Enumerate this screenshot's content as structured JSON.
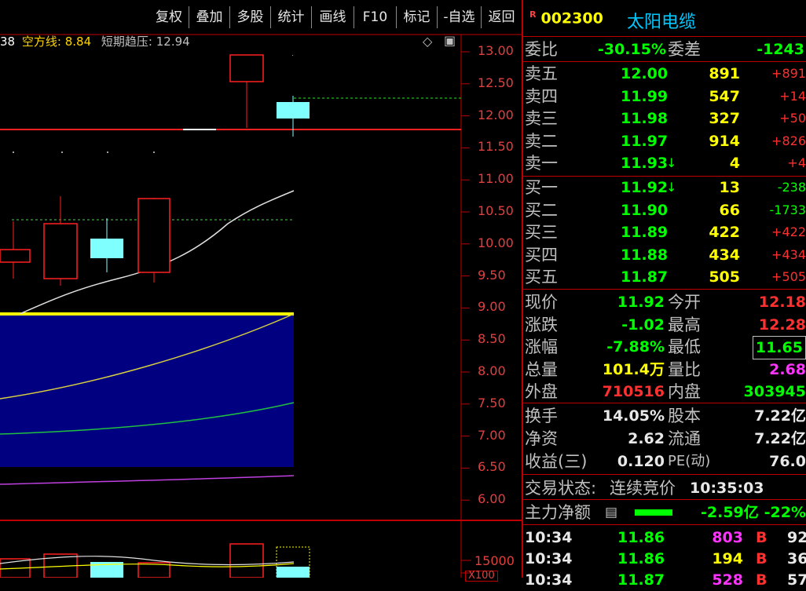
{
  "toolbar": {
    "buttons": [
      "复权",
      "叠加",
      "多股",
      "统计",
      "画线",
      "F10",
      "标记",
      "-自选",
      "返回"
    ]
  },
  "chart": {
    "legend_prefix": "38",
    "legend_label1": "空方线:",
    "legend_value1": "8.84",
    "legend_label2": "短期趋压:",
    "legend_value2": "12.94",
    "y_labels": [
      "13.00",
      "12.50",
      "12.00",
      "11.50",
      "11.00",
      "10.50",
      "10.00",
      "9.50",
      "9.00",
      "8.50",
      "8.00",
      "7.50",
      "7.00",
      "6.50",
      "6.00"
    ],
    "vol_label": "15000",
    "vol_unit": "X100",
    "diamond_icon": "◇",
    "window_icon": "▣"
  },
  "stock": {
    "badge": "R",
    "code": "002300",
    "name": "太阳电缆"
  },
  "quote": {
    "weibi_label": "委比",
    "weibi": "-30.15%",
    "weicha_label": "委差",
    "weicha": "-1243",
    "asks": [
      {
        "label": "卖五",
        "price": "12.00",
        "vol": "891",
        "chg": "+891"
      },
      {
        "label": "卖四",
        "price": "11.99",
        "vol": "547",
        "chg": "+14"
      },
      {
        "label": "卖三",
        "price": "11.98",
        "vol": "327",
        "chg": "+50"
      },
      {
        "label": "卖二",
        "price": "11.97",
        "vol": "914",
        "chg": "+826"
      },
      {
        "label": "卖一",
        "price": "11.93",
        "arrow": "↓",
        "vol": "4",
        "chg": "+4"
      }
    ],
    "bids": [
      {
        "label": "买一",
        "price": "11.92",
        "arrow": "↓",
        "vol": "13",
        "chg": "-238"
      },
      {
        "label": "买二",
        "price": "11.90",
        "vol": "66",
        "chg": "-1733"
      },
      {
        "label": "买三",
        "price": "11.89",
        "vol": "422",
        "chg": "+422"
      },
      {
        "label": "买四",
        "price": "11.88",
        "vol": "434",
        "chg": "+434"
      },
      {
        "label": "买五",
        "price": "11.87",
        "vol": "505",
        "chg": "+505"
      }
    ],
    "stats": [
      {
        "l1": "现价",
        "v1": "11.92",
        "l2": "今开",
        "v2": "12.18"
      },
      {
        "l1": "涨跌",
        "v1": "-1.02",
        "l2": "最高",
        "v2": "12.28"
      },
      {
        "l1": "涨幅",
        "v1": "-7.88%",
        "l2": "最低",
        "v2": "11.65"
      },
      {
        "l1": "总量",
        "v1": "101.4万",
        "l2": "量比",
        "v2": "2.68"
      },
      {
        "l1": "外盘",
        "v1": "710516",
        "l2": "内盘",
        "v2": "303945"
      }
    ],
    "fund": [
      {
        "l1": "换手",
        "v1": "14.05%",
        "l2": "股本",
        "v2": "7.22亿"
      },
      {
        "l1": "净资",
        "v1": "2.62",
        "l2": "流通",
        "v2": "7.22亿"
      },
      {
        "l1": "收益(三)",
        "v1": "0.120",
        "l2": "PE(动)",
        "v2": "76.0"
      }
    ],
    "trade_status_label": "交易状态:",
    "trade_status": "连续竞价",
    "trade_time": "10:35:03",
    "main_net_label": "主力净额",
    "main_net_icon": "▤",
    "main_net": "-2.59亿",
    "main_net_pct": "-22%",
    "ticks": [
      {
        "time": "10:34",
        "price": "11.86",
        "vol": "803",
        "side": "B",
        "count": "92"
      },
      {
        "time": "10:34",
        "price": "11.86",
        "vol": "194",
        "side": "B",
        "count": "36"
      },
      {
        "time": "10:34",
        "price": "11.87",
        "vol": "528",
        "side": "B",
        "count": "57"
      }
    ]
  }
}
